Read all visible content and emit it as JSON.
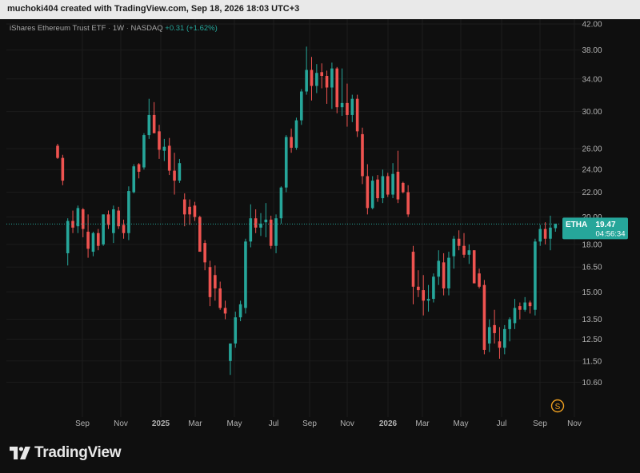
{
  "header": {
    "attribution": "muchoki404 created with TradingView.com, Sep 18, 2026 18:03 UTC+3"
  },
  "legend": {
    "name": "iShares Ethereum Trust ETF",
    "interval": "1W",
    "exchange": "NASDAQ",
    "change": "+0.31 (+1.62%)"
  },
  "price_tag": {
    "symbol": "ETHA",
    "price": "19.47",
    "countdown": "04:56:34"
  },
  "currency_icon": "S",
  "brand": {
    "logo_icon": "tradingview-logo-icon",
    "name": "TradingView"
  },
  "colors": {
    "up": "#26a69a",
    "down": "#ef5350",
    "tag": "#26a69a",
    "currency": "#f0a020"
  },
  "chart_data": {
    "type": "candlestick",
    "scale": "log",
    "ylim": [
      9.5,
      42
    ],
    "current_price": 19.47,
    "y_ticks": [
      "10.60",
      "11.50",
      "12.50",
      "13.50",
      "15.00",
      "16.50",
      "18.00",
      "20.00",
      "22.00",
      "24.00",
      "26.00",
      "30.00",
      "34.00",
      "38.00",
      "42.00"
    ],
    "x_ticks": [
      "Sep",
      "Nov",
      "2025",
      "Mar",
      "May",
      "Jul",
      "Sep",
      "Nov",
      "2026",
      "Mar",
      "May",
      "Jul",
      "Sep",
      "Nov"
    ],
    "grid": true,
    "candles": [
      [
        26.3,
        26.5,
        25.0,
        25.1
      ],
      [
        25.1,
        25.4,
        22.6,
        23.0
      ],
      [
        17.4,
        19.9,
        16.6,
        19.7
      ],
      [
        19.7,
        20.5,
        18.8,
        19.2
      ],
      [
        19.3,
        20.9,
        18.8,
        20.7
      ],
      [
        20.6,
        20.7,
        18.5,
        19.1
      ],
      [
        18.9,
        20.2,
        17.1,
        17.7
      ],
      [
        17.5,
        18.9,
        17.2,
        18.8
      ],
      [
        18.8,
        19.1,
        17.6,
        17.9
      ],
      [
        18.0,
        20.2,
        17.9,
        20.2
      ],
      [
        20.2,
        20.5,
        19.1,
        19.4
      ],
      [
        18.8,
        20.9,
        18.1,
        20.6
      ],
      [
        20.5,
        20.8,
        19.1,
        19.3
      ],
      [
        19.4,
        19.8,
        18.4,
        18.8
      ],
      [
        18.8,
        22.5,
        18.3,
        22.1
      ],
      [
        22.0,
        24.5,
        21.9,
        24.3
      ],
      [
        24.5,
        24.6,
        23.2,
        23.8
      ],
      [
        24.2,
        27.6,
        24.0,
        27.4
      ],
      [
        27.4,
        31.5,
        27.0,
        29.6
      ],
      [
        29.6,
        31.1,
        27.6,
        27.6
      ],
      [
        27.8,
        28.5,
        25.0,
        25.9
      ],
      [
        25.8,
        27.0,
        24.8,
        26.2
      ],
      [
        26.3,
        27.1,
        23.5,
        23.9
      ],
      [
        23.9,
        25.6,
        21.8,
        23.0
      ],
      [
        23.0,
        25.0,
        22.8,
        24.6
      ],
      [
        21.4,
        21.9,
        19.3,
        20.2
      ],
      [
        20.8,
        21.4,
        19.4,
        20.2
      ],
      [
        20.9,
        21.2,
        19.7,
        20.0
      ],
      [
        20.0,
        20.1,
        17.6,
        17.5
      ],
      [
        18.1,
        18.3,
        16.3,
        16.8
      ],
      [
        16.5,
        16.9,
        14.2,
        14.7
      ],
      [
        16.0,
        16.6,
        14.5,
        15.2
      ],
      [
        15.2,
        15.6,
        14.0,
        14.1
      ],
      [
        14.1,
        14.5,
        13.5,
        13.8
      ],
      [
        11.5,
        12.2,
        10.9,
        12.3
      ],
      [
        12.3,
        13.9,
        12.1,
        13.6
      ],
      [
        13.6,
        14.5,
        13.4,
        14.3
      ],
      [
        14.1,
        18.4,
        13.8,
        18.2
      ],
      [
        18.2,
        21.0,
        17.8,
        19.9
      ],
      [
        19.9,
        20.6,
        18.8,
        19.2
      ],
      [
        19.2,
        20.3,
        18.6,
        19.5
      ],
      [
        19.6,
        21.1,
        18.5,
        19.8
      ],
      [
        19.8,
        20.1,
        17.7,
        17.9
      ],
      [
        17.9,
        20.2,
        17.4,
        19.9
      ],
      [
        19.9,
        22.5,
        19.5,
        22.4
      ],
      [
        22.4,
        27.4,
        22.0,
        27.2
      ],
      [
        27.2,
        28.1,
        25.6,
        26.1
      ],
      [
        26.1,
        29.3,
        25.9,
        29.0
      ],
      [
        29.0,
        32.7,
        28.5,
        32.4
      ],
      [
        32.4,
        38.5,
        32.0,
        35.2
      ],
      [
        35.2,
        37.0,
        31.3,
        33.1
      ],
      [
        33.1,
        36.0,
        32.2,
        34.8
      ],
      [
        34.9,
        36.1,
        32.8,
        34.4
      ],
      [
        34.4,
        35.1,
        30.9,
        32.9
      ],
      [
        32.9,
        36.2,
        30.3,
        35.4
      ],
      [
        35.4,
        35.6,
        29.8,
        30.5
      ],
      [
        30.5,
        35.4,
        29.5,
        31.0
      ],
      [
        31.0,
        33.4,
        28.3,
        29.6
      ],
      [
        29.6,
        32.0,
        28.8,
        31.5
      ],
      [
        31.5,
        32.0,
        27.2,
        27.8
      ],
      [
        27.5,
        28.2,
        22.7,
        23.4
      ],
      [
        23.4,
        24.5,
        20.2,
        20.7
      ],
      [
        20.7,
        23.4,
        20.6,
        23.0
      ],
      [
        23.1,
        23.5,
        21.2,
        21.5
      ],
      [
        21.5,
        24.0,
        21.1,
        23.4
      ],
      [
        23.4,
        23.7,
        21.6,
        21.8
      ],
      [
        21.8,
        24.6,
        21.5,
        23.6
      ],
      [
        23.8,
        25.8,
        21.1,
        21.4
      ],
      [
        22.8,
        22.9,
        21.9,
        22.0
      ],
      [
        22.0,
        22.6,
        20.0,
        20.2
      ],
      [
        17.5,
        17.9,
        14.3,
        15.3
      ],
      [
        15.3,
        16.3,
        14.7,
        15.1
      ],
      [
        15.1,
        16.0,
        13.7,
        14.5
      ],
      [
        14.5,
        15.4,
        13.9,
        14.6
      ],
      [
        14.6,
        16.1,
        14.4,
        15.9
      ],
      [
        15.9,
        17.6,
        15.4,
        16.9
      ],
      [
        16.8,
        17.4,
        14.8,
        15.2
      ],
      [
        15.2,
        17.5,
        14.8,
        17.1
      ],
      [
        17.2,
        18.6,
        16.4,
        18.4
      ],
      [
        18.4,
        19.0,
        17.6,
        17.9
      ],
      [
        17.9,
        18.8,
        17.1,
        17.3
      ],
      [
        17.3,
        18.0,
        16.7,
        17.6
      ],
      [
        17.6,
        17.6,
        15.5,
        15.5
      ],
      [
        16.1,
        16.4,
        15.2,
        15.3
      ],
      [
        15.4,
        15.7,
        11.8,
        12.0
      ],
      [
        12.3,
        13.5,
        11.9,
        13.1
      ],
      [
        13.2,
        14.0,
        12.3,
        12.8
      ],
      [
        12.4,
        13.1,
        11.6,
        12.1
      ],
      [
        12.1,
        13.2,
        11.8,
        13.0
      ],
      [
        13.0,
        13.6,
        12.4,
        13.5
      ],
      [
        13.3,
        14.6,
        13.0,
        14.1
      ],
      [
        14.2,
        14.4,
        13.5,
        14.0
      ],
      [
        14.0,
        14.7,
        13.9,
        14.4
      ],
      [
        14.4,
        14.5,
        13.8,
        14.2
      ],
      [
        14.0,
        18.4,
        13.7,
        18.2
      ],
      [
        18.2,
        19.4,
        17.9,
        19.1
      ],
      [
        19.1,
        19.6,
        18.0,
        18.4
      ],
      [
        18.4,
        20.1,
        17.6,
        19.2
      ],
      [
        19.16,
        19.5,
        18.9,
        19.47
      ]
    ]
  }
}
